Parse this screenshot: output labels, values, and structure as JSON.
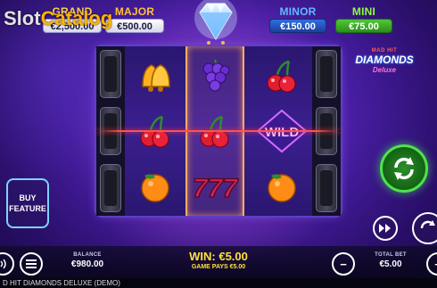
{
  "watermark": {
    "part1": "Slot",
    "part2": "Catalog"
  },
  "jackpots": {
    "grand": {
      "label": "GRAND",
      "value": "€2,500.00"
    },
    "major": {
      "label": "MAJOR",
      "value": "€500.00"
    },
    "minor": {
      "label": "MINOR",
      "value": "€150.00"
    },
    "mini": {
      "label": "MINI",
      "value": "€75.00"
    }
  },
  "logo": {
    "line1": "MAD HIT",
    "line2": "DIAMONDS",
    "line3": "Deluxe"
  },
  "reels": [
    [
      "bell-symbol",
      "cherry-symbol",
      "orange-symbol"
    ],
    [
      "grape-symbol",
      "cherry-symbol",
      "seven-symbol"
    ],
    [
      "cherry-symbol",
      "wild-symbol",
      "orange-symbol"
    ]
  ],
  "wild_text": "WILD",
  "seven_text": "777",
  "buy_feature": {
    "line1": "BUY",
    "line2": "FEATURE"
  },
  "balance": {
    "label": "BALANCE",
    "value": "€980.00"
  },
  "win": {
    "text": "WIN: €5.00",
    "game_pays": "GAME PAYS €5.00"
  },
  "total_bet": {
    "label": "TOTAL BET",
    "value": "€5.00"
  },
  "minus_label": "−",
  "plus_label": "+",
  "status_bar": "D HIT DIAMONDS DELUXE (DEMO)",
  "colors": {
    "background": "#4a1fa8",
    "accent_win": "#ffe23a",
    "spin_green": "#4de34d",
    "payline_red": "#ff5252"
  }
}
